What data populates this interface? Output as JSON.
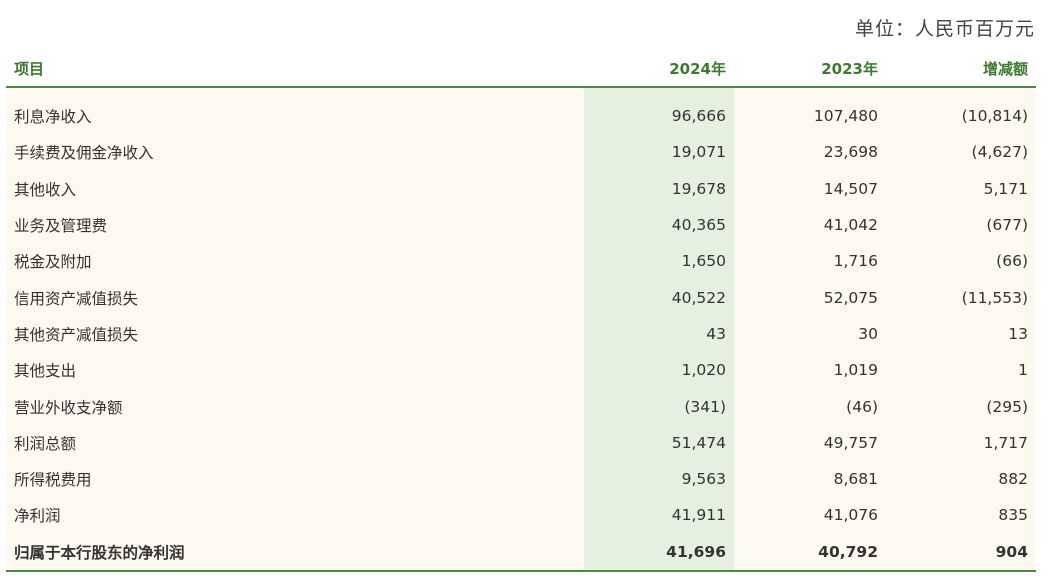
{
  "unit": "单位：人民币百万元",
  "header": {
    "item": "项目",
    "y2024": "2024年",
    "y2023": "2023年",
    "diff": "增减额"
  },
  "rows": [
    {
      "item": "利息净收入",
      "y2024": "96,666",
      "y2023": "107,480",
      "diff": "(10,814)"
    },
    {
      "item": "手续费及佣金净收入",
      "y2024": "19,071",
      "y2023": "23,698",
      "diff": "(4,627)"
    },
    {
      "item": "其他收入",
      "y2024": "19,678",
      "y2023": "14,507",
      "diff": "5,171"
    },
    {
      "item": "业务及管理费",
      "y2024": "40,365",
      "y2023": "41,042",
      "diff": "(677)"
    },
    {
      "item": "税金及附加",
      "y2024": "1,650",
      "y2023": "1,716",
      "diff": "(66)"
    },
    {
      "item": "信用资产减值损失",
      "y2024": "40,522",
      "y2023": "52,075",
      "diff": "(11,553)"
    },
    {
      "item": "其他资产减值损失",
      "y2024": "43",
      "y2023": "30",
      "diff": "13"
    },
    {
      "item": "其他支出",
      "y2024": "1,020",
      "y2023": "1,019",
      "diff": "1"
    },
    {
      "item": "营业外收支净额",
      "y2024": "(341)",
      "y2023": "(46)",
      "diff": "(295)"
    },
    {
      "item": "利润总额",
      "y2024": "51,474",
      "y2023": "49,757",
      "diff": "1,717"
    },
    {
      "item": "所得税费用",
      "y2024": "9,563",
      "y2023": "8,681",
      "diff": "882"
    },
    {
      "item": "净利润",
      "y2024": "41,911",
      "y2023": "41,076",
      "diff": "835"
    },
    {
      "item": "归属于本行股东的净利润",
      "y2024": "41,696",
      "y2023": "40,792",
      "diff": "904"
    }
  ],
  "colors": {
    "accent_green": "#4e8a3e",
    "header_text": "#3d7a2f",
    "row_background": "#fdf9f1",
    "highlight_column": "#e6f0e1"
  }
}
